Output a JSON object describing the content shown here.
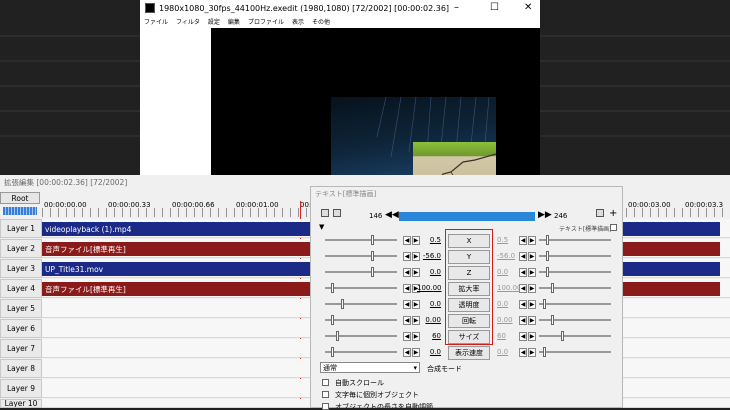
{
  "preview": {
    "title": "1980x1080_30fps_44100Hz.exedit  (1980,1080)  [72/2002]  [00:00:02.36]",
    "window_controls": [
      "–",
      "☐",
      "✕"
    ],
    "menu": [
      "ファイル",
      "フィルタ",
      "設定",
      "編集",
      "プロファイル",
      "表示",
      "その他"
    ]
  },
  "timeline": {
    "title": "拡張編集 [00:00:02.36] [72/2002]",
    "root_label": "Root",
    "ticks": [
      "00:00:00.00",
      "00:00:00.33",
      "00:00:00.66",
      "00:00:01.00",
      "00:00:01.33",
      "00:00:03.00",
      "00:00:03.3"
    ],
    "layers": [
      "Layer 1",
      "Layer 2",
      "Layer 3",
      "Layer 4",
      "Layer 5",
      "Layer 6",
      "Layer 7",
      "Layer 8",
      "Layer 9",
      "Layer 10"
    ],
    "objects": [
      {
        "label": "videoplayback (1).mp4",
        "color": "blue"
      },
      {
        "label": "音声ファイル[標準再生]",
        "color": "red"
      },
      {
        "label": "UP_Title31.mov",
        "color": "blue"
      },
      {
        "label": "音声ファイル[標準再生]",
        "color": "red"
      }
    ]
  },
  "settings": {
    "title": "テキスト[標準描画]",
    "frame_start": "146",
    "frame_end": "246",
    "right_caption": "テキスト[標準描画]",
    "params": [
      {
        "left": "0.5",
        "label": "X",
        "right": "0.5"
      },
      {
        "left": "-56.0",
        "label": "Y",
        "right": "-56.0"
      },
      {
        "left": "0.0",
        "label": "Z",
        "right": "0.0"
      },
      {
        "left": "100.00",
        "label": "拡大率",
        "right": "100.00"
      },
      {
        "left": "0.0",
        "label": "透明度",
        "right": "0.0"
      },
      {
        "left": "0.00",
        "label": "回転",
        "right": "0.00"
      },
      {
        "left": "60",
        "label": "サイズ",
        "right": "60"
      },
      {
        "left": "0.0",
        "label": "表示速度",
        "right": "0.0"
      }
    ],
    "blend_value": "通常",
    "blend_label": "合成モード",
    "checkboxes": [
      "自動スクロール",
      "文字毎に個別オブジェクト",
      "オブジェクトの長さを自動調節"
    ],
    "accent_red": "#d41a1a",
    "accent_blue": "#2a86d8"
  }
}
